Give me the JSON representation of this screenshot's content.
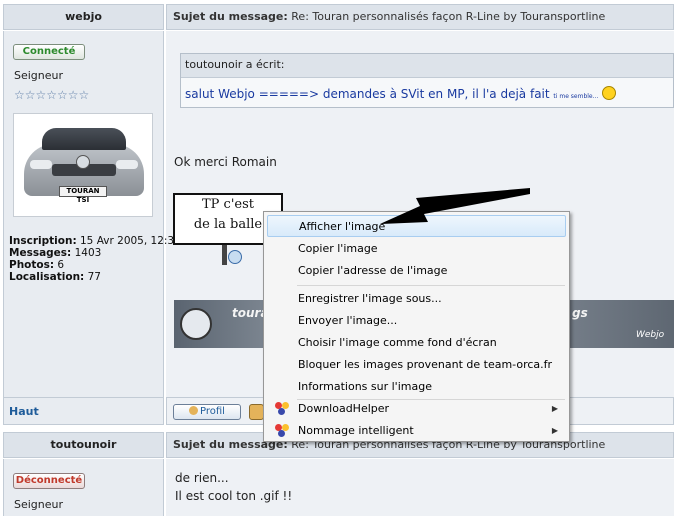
{
  "post1": {
    "author": "webjo",
    "subject_label": "Sujet du message:",
    "subject_value": "Re: Touran personnalisés façon R-Line by Touransportline",
    "status": "Connecté",
    "rank": "Seigneur",
    "stars": "☆☆☆☆☆☆☆",
    "avatar_plate": "TOURAN TSI",
    "info": {
      "inscription_label": "Inscription:",
      "inscription_value": "15 Avr 2005, 12:39",
      "messages_label": "Messages:",
      "messages_value": "1403",
      "photos_label": "Photos:",
      "photos_value": "6",
      "localisation_label": "Localisation:",
      "localisation_value": "77"
    },
    "quote": {
      "header": "toutounoir a écrit:",
      "text": "salut Webjo =====> demandes à SVit en MP, il l'a dejà fait",
      "small": "ti me semble..."
    },
    "body": "Ok merci Romain",
    "sign_line1": "TP c'est",
    "sign_line2": "de la balle",
    "banner_left": "touran",
    "banner_right": "gs",
    "banner_sig": "Webjo",
    "haut": "Haut",
    "profil": "Profil"
  },
  "post2": {
    "author": "toutounoir",
    "subject_label": "Sujet du message:",
    "subject_value": "Re: Touran personnalisés façon R-Line by Touransportline",
    "status": "Déconnecté",
    "rank": "Seigneur",
    "line1": "de rien...",
    "line2": "Il est cool ton .gif !!"
  },
  "context_menu": {
    "items": [
      {
        "label": "Afficher l'image",
        "active": true
      },
      {
        "label": "Copier l'image"
      },
      {
        "label": "Copier l'adresse de l'image"
      },
      {
        "label": "Enregistrer l'image sous..."
      },
      {
        "label": "Envoyer l'image..."
      },
      {
        "label": "Choisir l'image comme fond d'écran"
      },
      {
        "label": "Bloquer les images provenant de team-orca.fr"
      },
      {
        "label": "Informations sur l'image"
      },
      {
        "label": "DownloadHelper",
        "submenu": true,
        "icon": "downloadhelper-icon"
      },
      {
        "label": "Nommage intelligent",
        "submenu": true,
        "icon": "nommage-icon"
      }
    ]
  },
  "colors": {
    "connected": "#2c8a2c",
    "disconnected": "#c0392b",
    "link": "#1f5c9a",
    "quote_text": "#1a3aa0"
  }
}
